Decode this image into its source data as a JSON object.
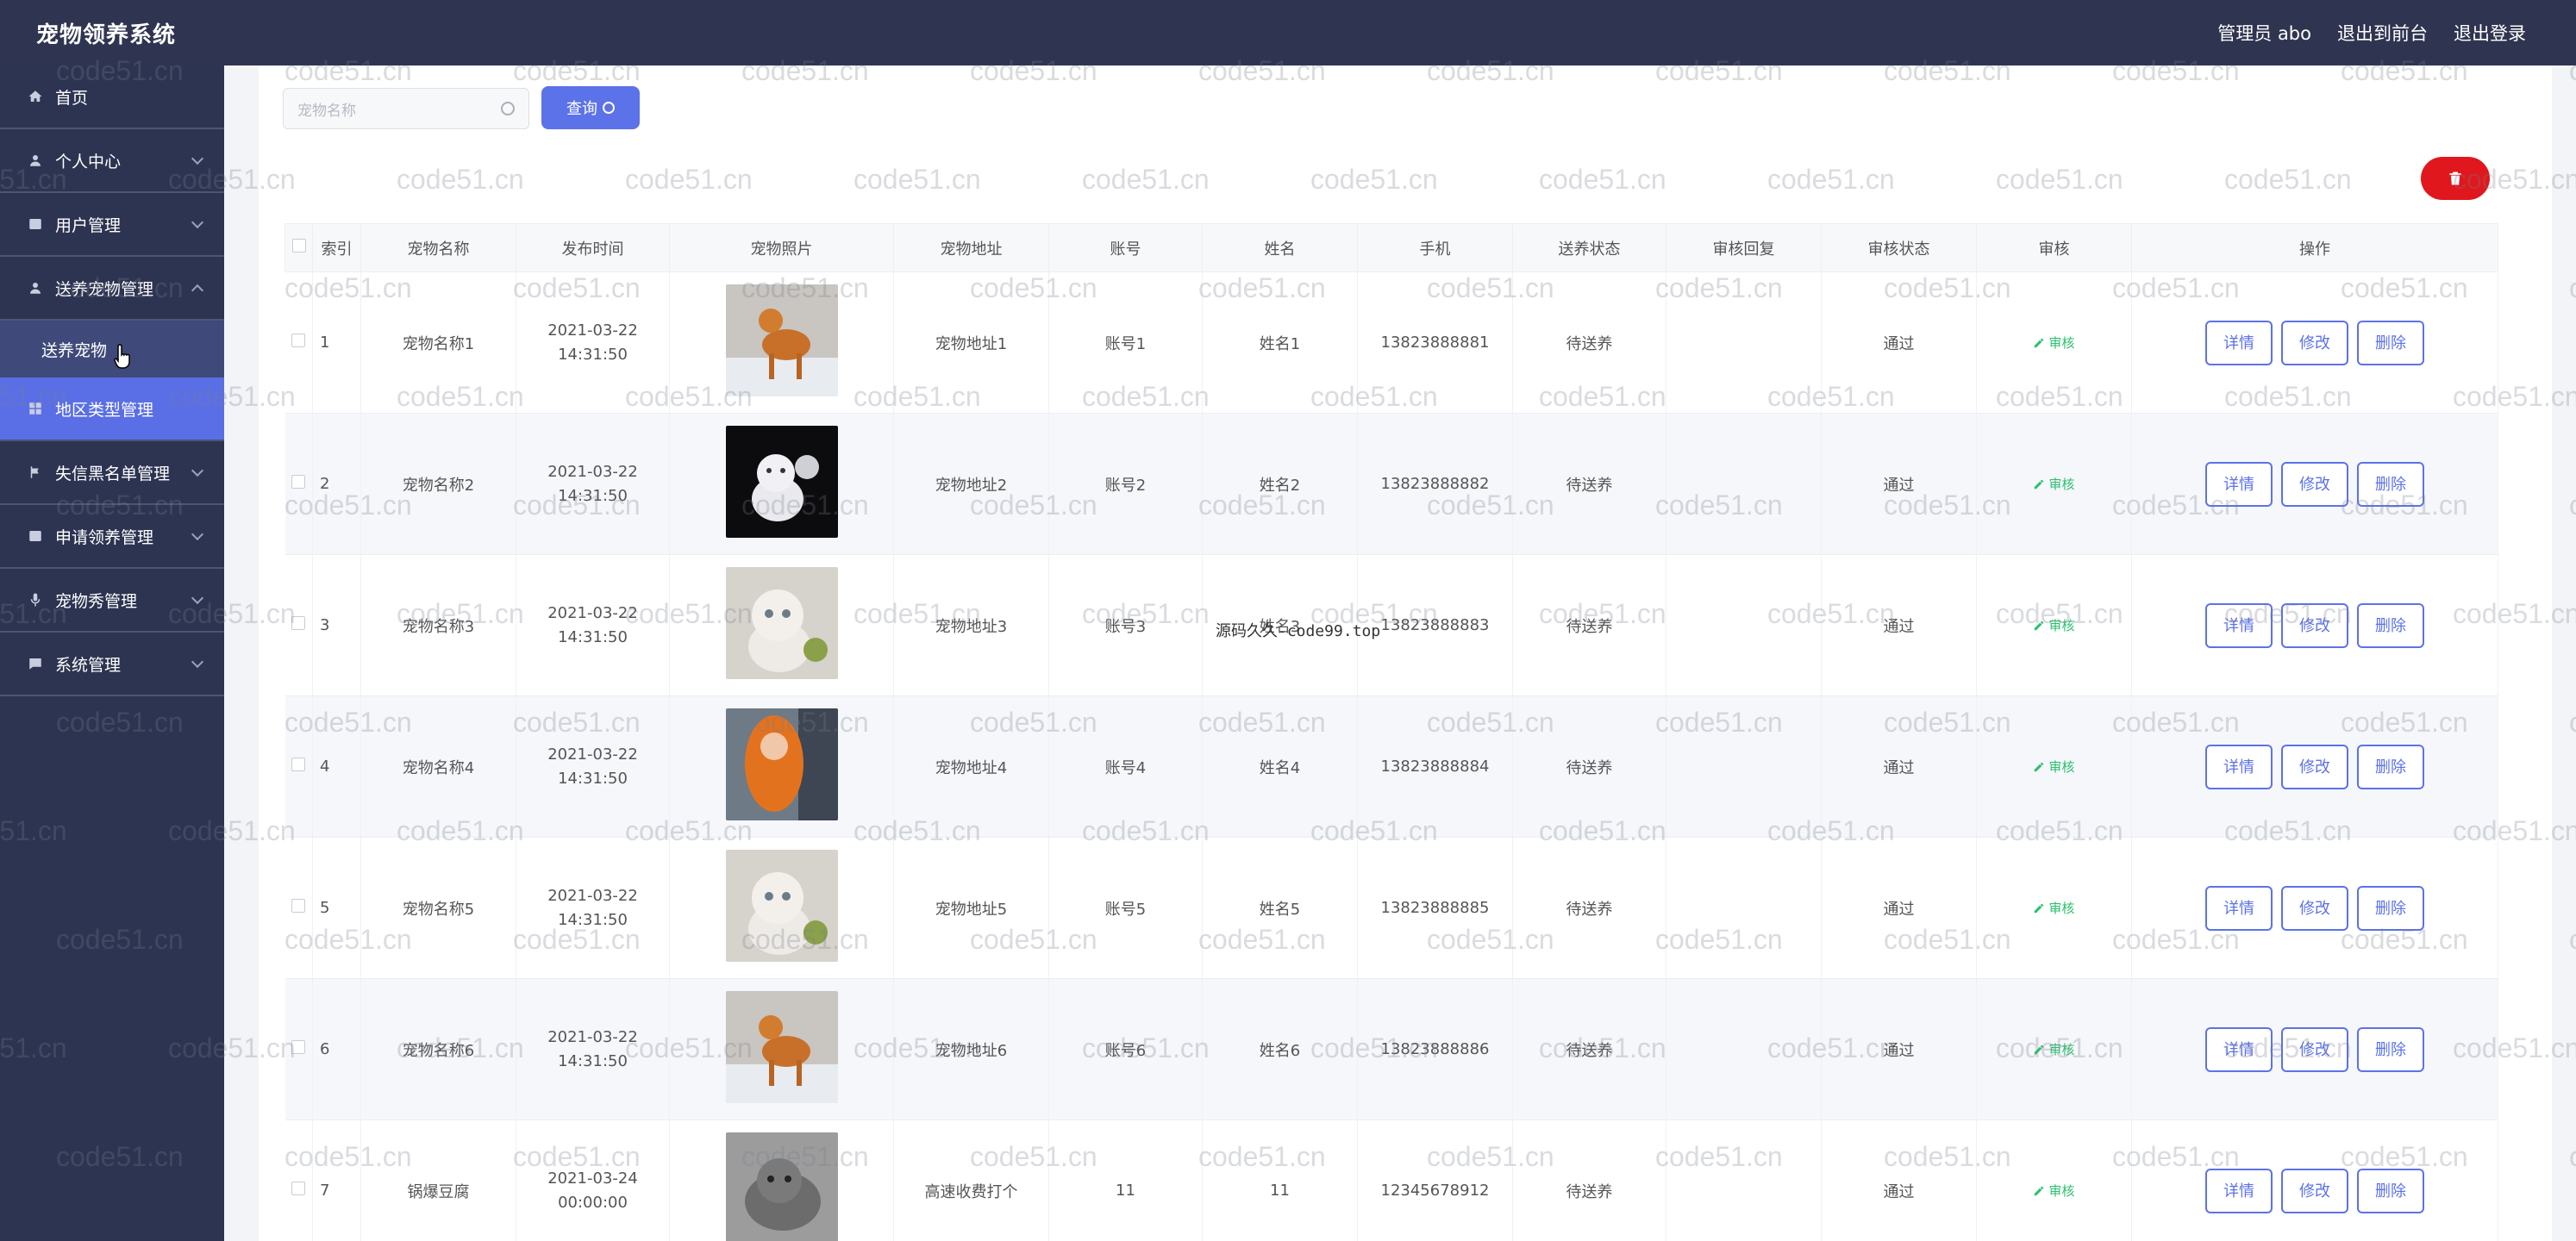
{
  "header": {
    "brand": "宠物领养系统",
    "admin": "管理员 abo",
    "to_front": "退出到前台",
    "logout": "退出登录"
  },
  "sidebar": {
    "items": [
      {
        "label": "首页",
        "icon": "home-icon"
      },
      {
        "label": "个人中心",
        "icon": "user-icon"
      },
      {
        "label": "用户管理",
        "icon": "grid-icon"
      },
      {
        "label": "送养宠物管理",
        "icon": "user-icon"
      },
      {
        "label": "送养宠物",
        "icon": ""
      },
      {
        "label": "地区类型管理",
        "icon": "grid-icon"
      },
      {
        "label": "失信黑名单管理",
        "icon": "flag-icon"
      },
      {
        "label": "申请领养管理",
        "icon": "grid-icon"
      },
      {
        "label": "宠物秀管理",
        "icon": "mic-icon"
      },
      {
        "label": "系统管理",
        "icon": "chat-icon"
      }
    ]
  },
  "search": {
    "placeholder": "宠物名称",
    "button": "查询"
  },
  "table": {
    "columns": [
      "索引",
      "宠物名称",
      "发布时间",
      "宠物照片",
      "宠物地址",
      "账号",
      "姓名",
      "手机",
      "送养状态",
      "审核回复",
      "审核状态",
      "审核",
      "操作"
    ],
    "audit_label": "审核",
    "btn_detail": "详情",
    "btn_edit": "修改",
    "btn_delete": "删除",
    "rows": [
      {
        "idx": "1",
        "name": "宠物名称1",
        "time": "2021-03-22 14:31:50",
        "photo": "orange-dog",
        "addr": "宠物地址1",
        "account": "账号1",
        "uname": "姓名1",
        "phone": "13823888881",
        "status": "待送养",
        "reply": "",
        "audit_status": "通过"
      },
      {
        "idx": "2",
        "name": "宠物名称2",
        "time": "2021-03-22 14:31:50",
        "photo": "white-cat-dark",
        "addr": "宠物地址2",
        "account": "账号2",
        "uname": "姓名2",
        "phone": "13823888882",
        "status": "待送养",
        "reply": "",
        "audit_status": "通过"
      },
      {
        "idx": "3",
        "name": "宠物名称3",
        "time": "2021-03-22 14:31:50",
        "photo": "white-cat",
        "addr": "宠物地址3",
        "account": "账号3",
        "uname": "姓名3",
        "phone": "13823888883",
        "status": "待送养",
        "reply": "",
        "audit_status": "通过"
      },
      {
        "idx": "4",
        "name": "宠物名称4",
        "time": "2021-03-22 14:31:50",
        "photo": "orange-hair",
        "addr": "宠物地址4",
        "account": "账号4",
        "uname": "姓名4",
        "phone": "13823888884",
        "status": "待送养",
        "reply": "",
        "audit_status": "通过"
      },
      {
        "idx": "5",
        "name": "宠物名称5",
        "time": "2021-03-22 14:31:50",
        "photo": "white-cat",
        "addr": "宠物地址5",
        "account": "账号5",
        "uname": "姓名5",
        "phone": "13823888885",
        "status": "待送养",
        "reply": "",
        "audit_status": "通过"
      },
      {
        "idx": "6",
        "name": "宠物名称6",
        "time": "2021-03-22 14:31:50",
        "photo": "orange-dog",
        "addr": "宠物地址6",
        "account": "账号6",
        "uname": "姓名6",
        "phone": "13823888886",
        "status": "待送养",
        "reply": "",
        "audit_status": "通过"
      },
      {
        "idx": "7",
        "name": "锅爆豆腐",
        "time": "2021-03-24 00:00:00",
        "photo": "grey-cat",
        "addr": "高速收费打个",
        "account": "11",
        "uname": "11",
        "phone": "12345678912",
        "status": "待送养",
        "reply": "",
        "audit_status": "通过"
      }
    ]
  },
  "watermark": "code51.cn",
  "center_watermark": "源码久久-code99.top",
  "colors": {
    "header_bg": "#2f3551",
    "sidebar_bg": "#2d3451",
    "accent": "#5c72e8",
    "danger": "#e0171c",
    "success": "#2bc06e"
  }
}
